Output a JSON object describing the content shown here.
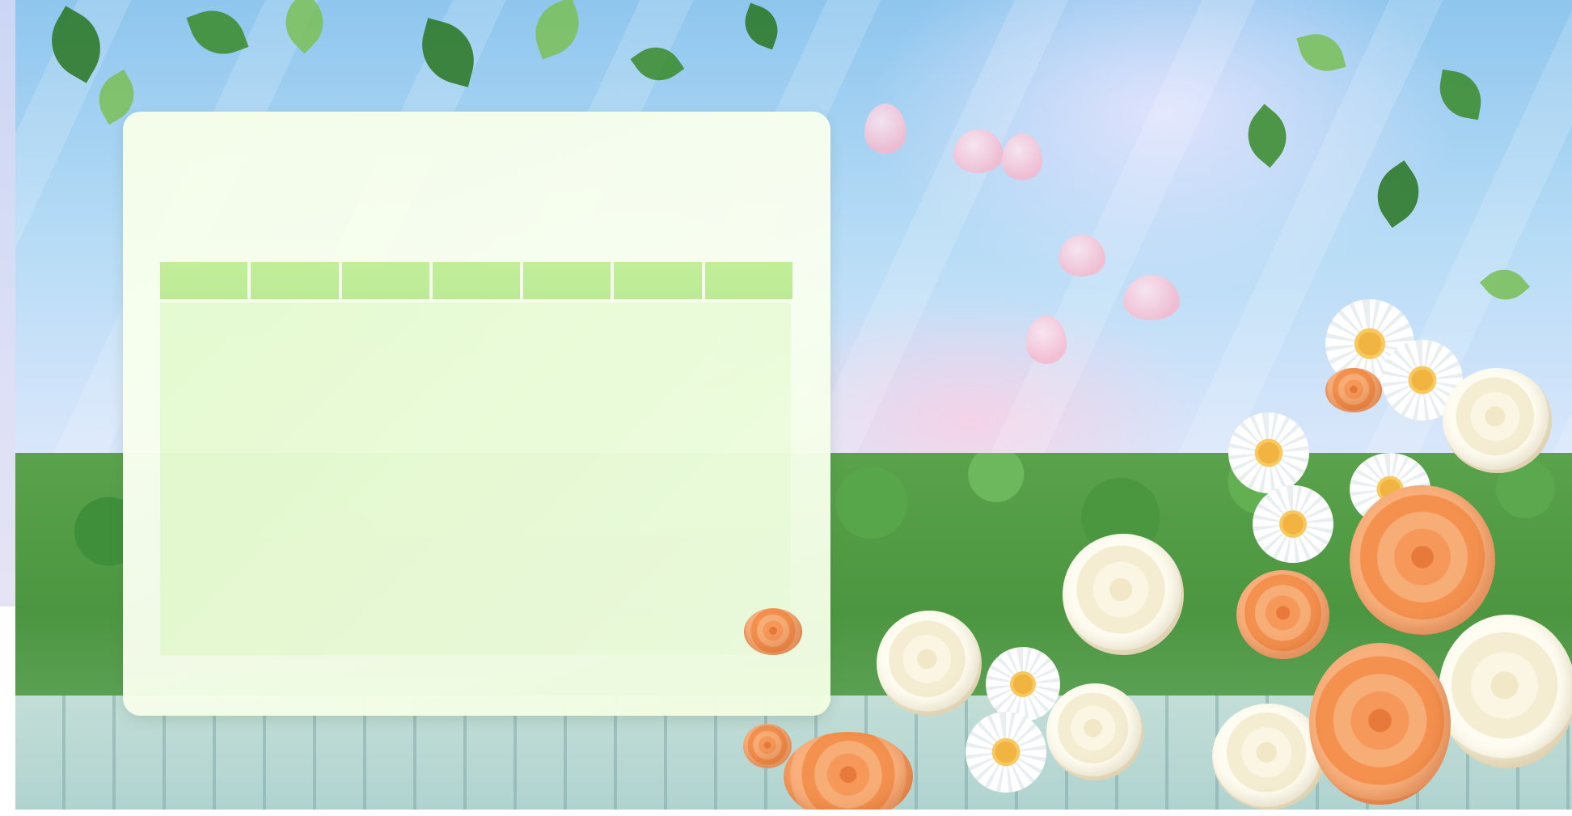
{
  "slide": {
    "title": "",
    "schedule": {
      "column_headers": [
        "",
        "",
        "",
        "",
        "",
        "",
        ""
      ],
      "rows": []
    }
  },
  "colors": {
    "sky": "#b7dcf6",
    "panel_background": "#f6ffe9",
    "header_cell": "#c2ef96",
    "table_body": "#e8fbd4",
    "foliage": "#4c9641",
    "peach_flower": "#f5985a",
    "cream_flower": "#fbf6e4"
  },
  "decorations": [
    "hanging-vines",
    "falling-pink-petals",
    "daisies",
    "peach-ranunculus",
    "cream-ranunculus",
    "garden-hedge",
    "white-picket-fence"
  ]
}
